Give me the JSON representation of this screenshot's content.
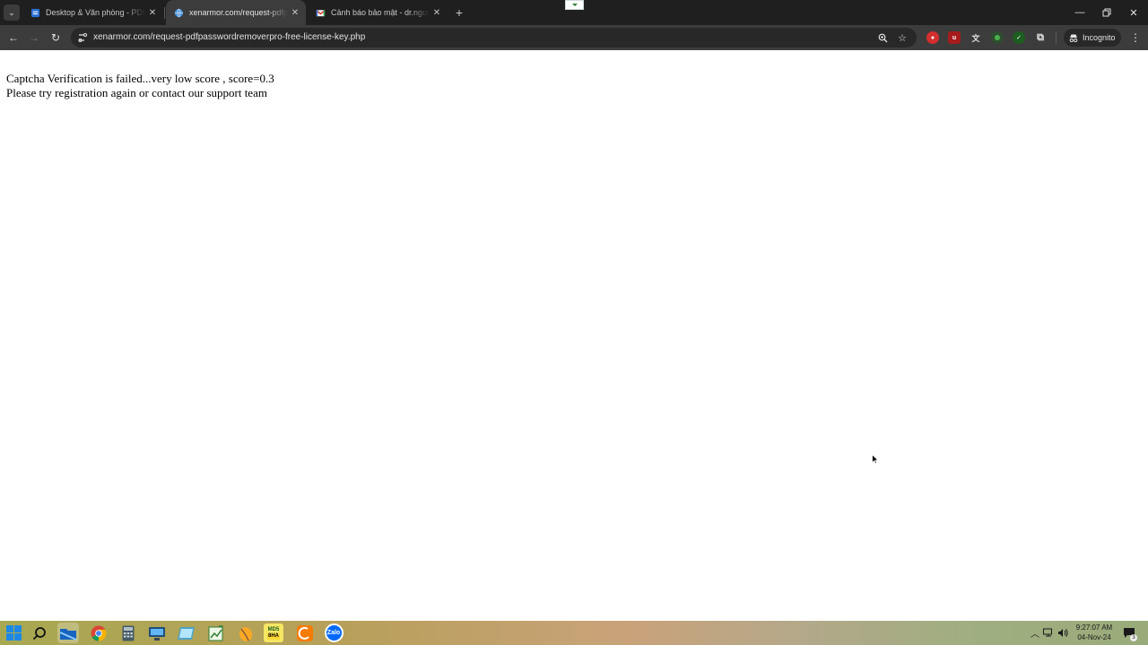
{
  "browser": {
    "tabs": [
      {
        "title": "Desktop & Văn phòng - PDF Pa",
        "icon": "blue-doc-icon",
        "active": false
      },
      {
        "title": "xenarmor.com/request-pdfpass",
        "icon": "globe-icon",
        "active": true
      },
      {
        "title": "Cảnh báo bảo mật - dr.nguyen",
        "icon": "gmail-icon",
        "active": false
      }
    ],
    "url": "xenarmor.com/request-pdfpasswordremoverpro-free-license-key.php",
    "profile_label": "Incognito"
  },
  "page": {
    "line1": "Captcha Verification is failed...very low score , score=0.3",
    "line2": "Please try registration again or contact our support team"
  },
  "taskbar": {
    "apps": [
      "start-icon",
      "search-icon",
      "file-explorer-icon",
      "chrome-icon",
      "calculator-icon",
      "network-monitor-icon",
      "image-viewer-icon",
      "chart-app-icon",
      "mango-app-icon",
      "md5-tool-icon",
      "orange-app-icon",
      "zalo-icon"
    ],
    "md5_badge_top": "MD5",
    "md5_badge_bottom": "8HA",
    "zalo_label": "Zalo",
    "clock_time": "9:27:07 AM",
    "clock_date": "04-Nov-24",
    "notification_count": "3"
  },
  "colors": {
    "chrome_dark": "#1f1f1f",
    "chrome_toolbar": "#3c3c3c",
    "page_background": "#ffffff"
  }
}
